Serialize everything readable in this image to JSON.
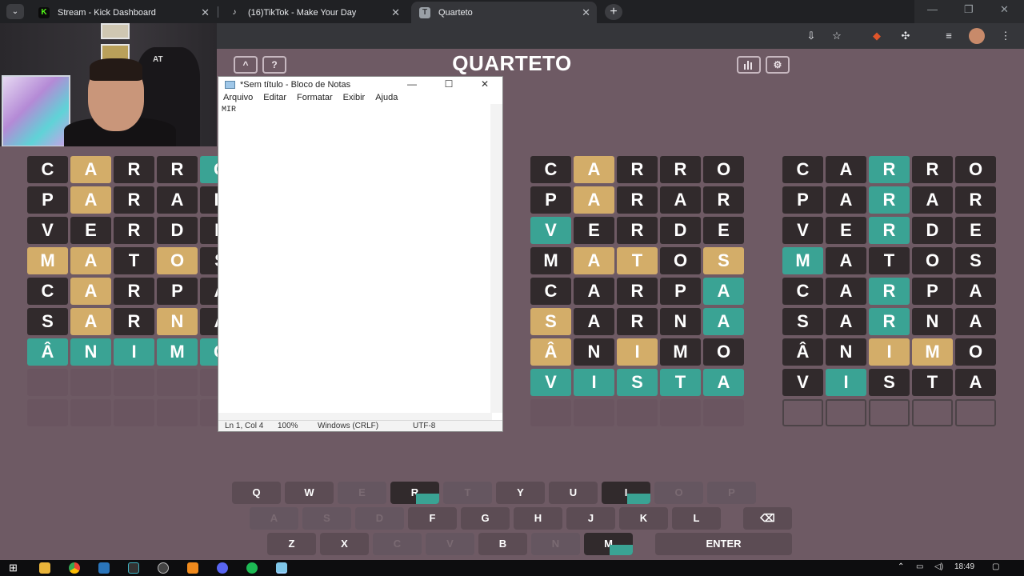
{
  "browser": {
    "tabs": [
      {
        "title": "Stream - Kick Dashboard",
        "favicon_color": "#53fc18",
        "favicon_glyph": "K"
      },
      {
        "title": "(16)TikTok - Make Your Day",
        "favicon_color": "#35363a",
        "favicon_glyph": "♪"
      },
      {
        "title": "Quarteto",
        "favicon_color": "#9aa0a6",
        "favicon_glyph": "T"
      }
    ],
    "new_tab_label": "+"
  },
  "webcam": {
    "chair_logo": "AT"
  },
  "game": {
    "title": "QUARTETO",
    "up_button": "^",
    "help_button": "?",
    "stats_icon": "bar-chart-icon",
    "settings_icon": "gear-icon"
  },
  "boards": [
    {
      "rows": [
        [
          [
            "C",
            "x"
          ],
          [
            "A",
            "y"
          ],
          [
            "R",
            "x"
          ],
          [
            "R",
            "x"
          ],
          [
            "O",
            "g"
          ]
        ],
        [
          [
            "P",
            "x"
          ],
          [
            "A",
            "y"
          ],
          [
            "R",
            "x"
          ],
          [
            "A",
            "x"
          ],
          [
            "R",
            "x"
          ]
        ],
        [
          [
            "V",
            "x"
          ],
          [
            "E",
            "x"
          ],
          [
            "R",
            "x"
          ],
          [
            "D",
            "x"
          ],
          [
            "E",
            "x"
          ]
        ],
        [
          [
            "M",
            "y"
          ],
          [
            "A",
            "y"
          ],
          [
            "T",
            "x"
          ],
          [
            "O",
            "y"
          ],
          [
            "S",
            "x"
          ]
        ],
        [
          [
            "C",
            "x"
          ],
          [
            "A",
            "y"
          ],
          [
            "R",
            "x"
          ],
          [
            "P",
            "x"
          ],
          [
            "A",
            "x"
          ]
        ],
        [
          [
            "S",
            "x"
          ],
          [
            "A",
            "y"
          ],
          [
            "R",
            "x"
          ],
          [
            "N",
            "y"
          ],
          [
            "A",
            "x"
          ]
        ],
        [
          [
            "Â",
            "g"
          ],
          [
            "N",
            "g"
          ],
          [
            "I",
            "g"
          ],
          [
            "M",
            "g"
          ],
          [
            "O",
            "g"
          ]
        ],
        [
          [
            "",
            "e"
          ],
          [
            "",
            "e"
          ],
          [
            "",
            "e"
          ],
          [
            "",
            "e"
          ],
          [
            "",
            "e"
          ]
        ],
        [
          [
            "",
            "e"
          ],
          [
            "",
            "e"
          ],
          [
            "",
            "e"
          ],
          [
            "",
            "e"
          ],
          [
            "",
            "e"
          ]
        ]
      ]
    },
    {
      "rows": [
        [
          [
            "C",
            "x"
          ],
          [
            "A",
            "y"
          ],
          [
            "R",
            "x"
          ],
          [
            "R",
            "x"
          ],
          [
            "O",
            "x"
          ]
        ],
        [
          [
            "P",
            "x"
          ],
          [
            "A",
            "y"
          ],
          [
            "R",
            "x"
          ],
          [
            "A",
            "x"
          ],
          [
            "R",
            "x"
          ]
        ],
        [
          [
            "V",
            "g"
          ],
          [
            "E",
            "x"
          ],
          [
            "R",
            "x"
          ],
          [
            "D",
            "x"
          ],
          [
            "E",
            "x"
          ]
        ],
        [
          [
            "M",
            "x"
          ],
          [
            "A",
            "y"
          ],
          [
            "T",
            "y"
          ],
          [
            "O",
            "x"
          ],
          [
            "S",
            "y"
          ]
        ],
        [
          [
            "C",
            "x"
          ],
          [
            "A",
            "x"
          ],
          [
            "R",
            "x"
          ],
          [
            "P",
            "x"
          ],
          [
            "A",
            "g"
          ]
        ],
        [
          [
            "S",
            "y"
          ],
          [
            "A",
            "x"
          ],
          [
            "R",
            "x"
          ],
          [
            "N",
            "x"
          ],
          [
            "A",
            "g"
          ]
        ],
        [
          [
            "Â",
            "y"
          ],
          [
            "N",
            "x"
          ],
          [
            "I",
            "y"
          ],
          [
            "M",
            "x"
          ],
          [
            "O",
            "x"
          ]
        ],
        [
          [
            "V",
            "g"
          ],
          [
            "I",
            "g"
          ],
          [
            "S",
            "g"
          ],
          [
            "T",
            "g"
          ],
          [
            "A",
            "g"
          ]
        ],
        [
          [
            "",
            "e"
          ],
          [
            "",
            "e"
          ],
          [
            "",
            "e"
          ],
          [
            "",
            "e"
          ],
          [
            "",
            "e"
          ]
        ]
      ]
    },
    {
      "rows": [
        [
          [
            "C",
            "x"
          ],
          [
            "A",
            "x"
          ],
          [
            "R",
            "g"
          ],
          [
            "R",
            "x"
          ],
          [
            "O",
            "x"
          ]
        ],
        [
          [
            "P",
            "x"
          ],
          [
            "A",
            "x"
          ],
          [
            "R",
            "g"
          ],
          [
            "A",
            "x"
          ],
          [
            "R",
            "x"
          ]
        ],
        [
          [
            "V",
            "x"
          ],
          [
            "E",
            "x"
          ],
          [
            "R",
            "g"
          ],
          [
            "D",
            "x"
          ],
          [
            "E",
            "x"
          ]
        ],
        [
          [
            "M",
            "g"
          ],
          [
            "A",
            "x"
          ],
          [
            "T",
            "x"
          ],
          [
            "O",
            "x"
          ],
          [
            "S",
            "x"
          ]
        ],
        [
          [
            "C",
            "x"
          ],
          [
            "A",
            "x"
          ],
          [
            "R",
            "g"
          ],
          [
            "P",
            "x"
          ],
          [
            "A",
            "x"
          ]
        ],
        [
          [
            "S",
            "x"
          ],
          [
            "A",
            "x"
          ],
          [
            "R",
            "g"
          ],
          [
            "N",
            "x"
          ],
          [
            "A",
            "x"
          ]
        ],
        [
          [
            "Â",
            "x"
          ],
          [
            "N",
            "x"
          ],
          [
            "I",
            "y"
          ],
          [
            "M",
            "y"
          ],
          [
            "O",
            "x"
          ]
        ],
        [
          [
            "V",
            "x"
          ],
          [
            "I",
            "g"
          ],
          [
            "S",
            "x"
          ],
          [
            "T",
            "x"
          ],
          [
            "A",
            "x"
          ]
        ],
        [
          [
            "",
            "o"
          ],
          [
            "",
            "o"
          ],
          [
            "",
            "o"
          ],
          [
            "",
            "o"
          ],
          [
            "",
            "o"
          ]
        ]
      ]
    }
  ],
  "notepad": {
    "title": "*Sem título - Bloco de Notas",
    "menu": [
      "Arquivo",
      "Editar",
      "Formatar",
      "Exibir",
      "Ajuda"
    ],
    "content": "MIR",
    "status": {
      "position": "Ln 1, Col 4",
      "zoom": "100%",
      "line_ending": "Windows (CRLF)",
      "encoding": "UTF-8"
    }
  },
  "keyboard": {
    "row1": [
      [
        "Q",
        "n"
      ],
      [
        "W",
        "n"
      ],
      [
        "E",
        "d"
      ],
      [
        "R",
        "x"
      ],
      [
        "T",
        "d"
      ],
      [
        "Y",
        "n"
      ],
      [
        "U",
        "n"
      ],
      [
        "I",
        "x"
      ],
      [
        "O",
        "d"
      ],
      [
        "P",
        "d"
      ]
    ],
    "row2": [
      [
        "A",
        "d"
      ],
      [
        "S",
        "d"
      ],
      [
        "D",
        "d"
      ],
      [
        "F",
        "n"
      ],
      [
        "G",
        "n"
      ],
      [
        "H",
        "n"
      ],
      [
        "J",
        "n"
      ],
      [
        "K",
        "n"
      ],
      [
        "L",
        "n"
      ]
    ],
    "row3": [
      [
        "Z",
        "n"
      ],
      [
        "X",
        "n"
      ],
      [
        "C",
        "d"
      ],
      [
        "V",
        "d"
      ],
      [
        "B",
        "n"
      ],
      [
        "N",
        "d"
      ],
      [
        "M",
        "x"
      ]
    ],
    "backspace_icon": "⌫",
    "enter_label": "ENTER"
  },
  "taskbar": {
    "time": "18:49",
    "apps": [
      "explorer",
      "chrome",
      "steam",
      "terminal",
      "obs",
      "vlc",
      "discord",
      "spotify",
      "notepad"
    ]
  },
  "colors": {
    "absent": "#312a2c",
    "present": "#d3ad69",
    "correct": "#3aa394",
    "background": "#6e5a64"
  }
}
